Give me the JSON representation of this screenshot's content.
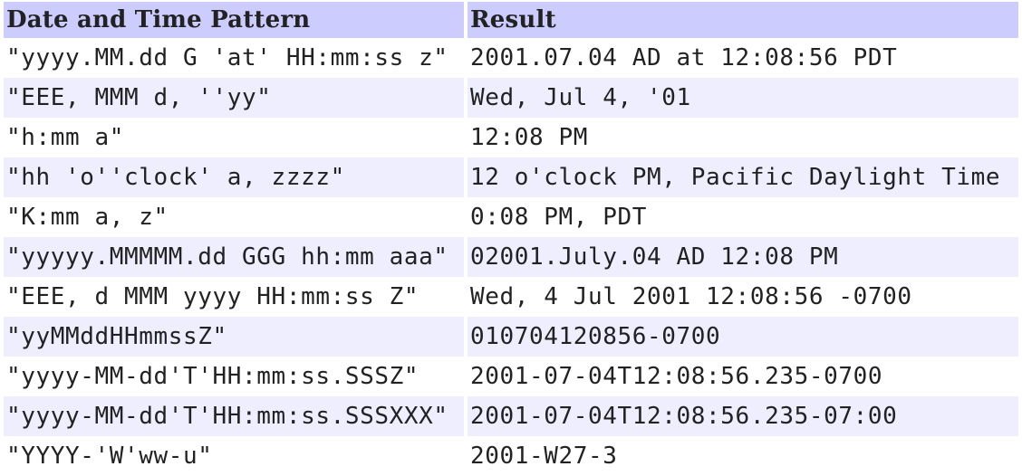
{
  "table": {
    "headers": [
      "Date and Time Pattern",
      "Result"
    ],
    "rows": [
      {
        "pattern": "\"yyyy.MM.dd G 'at' HH:mm:ss z\"",
        "result": "2001.07.04 AD at 12:08:56 PDT"
      },
      {
        "pattern": "\"EEE, MMM d, ''yy\"",
        "result": "Wed, Jul 4, '01"
      },
      {
        "pattern": "\"h:mm a\"",
        "result": "12:08 PM"
      },
      {
        "pattern": "\"hh 'o''clock' a, zzzz\"",
        "result": "12 o'clock PM, Pacific Daylight Time"
      },
      {
        "pattern": "\"K:mm a, z\"",
        "result": "0:08 PM, PDT"
      },
      {
        "pattern": "\"yyyyy.MMMMM.dd GGG hh:mm aaa\"",
        "result": "02001.July.04 AD 12:08 PM"
      },
      {
        "pattern": "\"EEE, d MMM yyyy HH:mm:ss Z\"",
        "result": "Wed, 4 Jul 2001 12:08:56 -0700"
      },
      {
        "pattern": "\"yyMMddHHmmssZ\"",
        "result": "010704120856-0700"
      },
      {
        "pattern": "\"yyyy-MM-dd'T'HH:mm:ss.SSSZ\"",
        "result": "2001-07-04T12:08:56.235-0700"
      },
      {
        "pattern": "\"yyyy-MM-dd'T'HH:mm:ss.SSSXXX\"",
        "result": "2001-07-04T12:08:56.235-07:00"
      },
      {
        "pattern": "\"YYYY-'W'ww-u\"",
        "result": "2001-W27-3"
      }
    ]
  },
  "colors": {
    "header_bg": "#ccccff",
    "alt_row_bg": "#eeeeff",
    "row_bg": "#ffffff"
  }
}
